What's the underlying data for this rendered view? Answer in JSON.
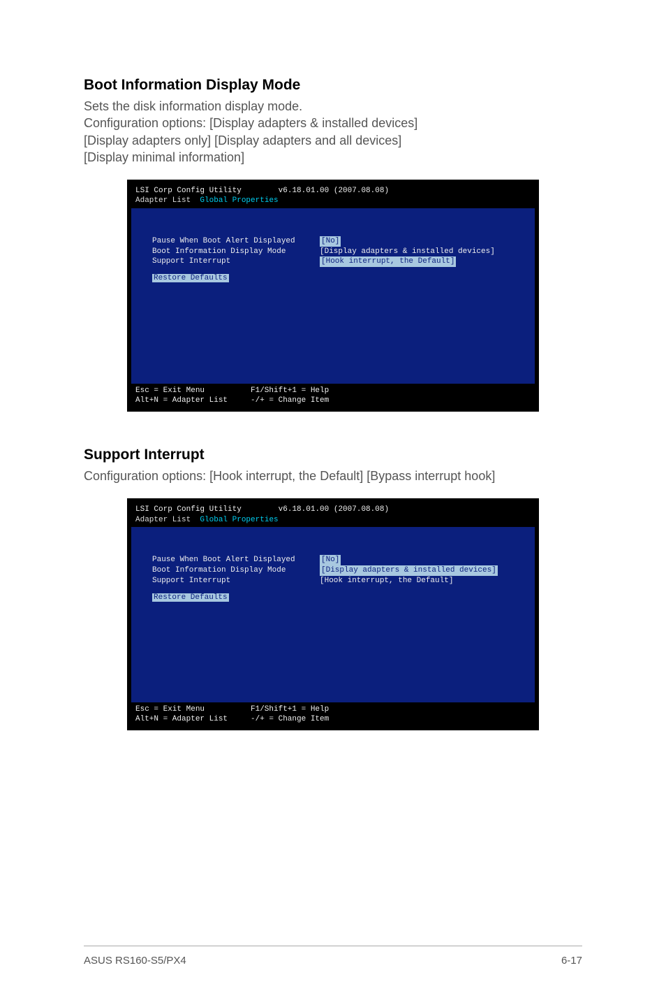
{
  "section1": {
    "heading": "Boot Information Display Mode",
    "text": "Sets the disk information display mode.\nConfiguration options: [Display adapters & installed devices] [Display adapters only] [Display adapters and all devices] [Display minimal information]"
  },
  "bios": {
    "title": "LSI Corp Config Utility",
    "version": "v6.18.01.00 (2007.08.08)",
    "breadcrumb1": "Adapter List",
    "breadcrumb2": "Global Properties",
    "rows": {
      "pause_label": "Pause When Boot Alert Displayed",
      "pause_value": "[No]",
      "bootinfo_label": "Boot Information Display Mode",
      "bootinfo_value": "[Display adapters & installed devices]",
      "support_label": "Support Interrupt",
      "support_value": "[Hook interrupt, the Default]"
    },
    "restore": "Restore Defaults",
    "footer": {
      "esc": "Esc = Exit Menu",
      "f1": "F1/Shift+1 = Help",
      "altn": "Alt+N = Adapter List",
      "change": "-/+ = Change Item"
    }
  },
  "section2": {
    "heading": "Support Interrupt",
    "text": "Configuration options: [Hook interrupt, the Default] [Bypass interrupt hook]"
  },
  "footer": {
    "left": "ASUS RS160-S5/PX4",
    "right": "6-17"
  }
}
